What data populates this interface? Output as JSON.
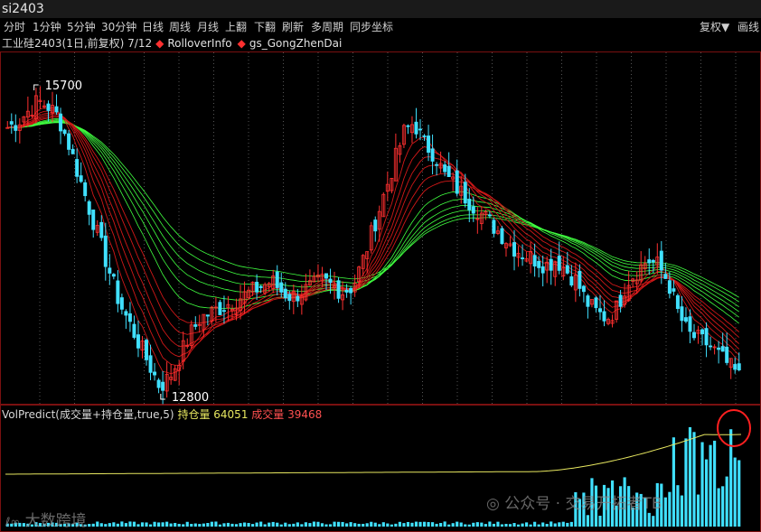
{
  "window": {
    "title": "si2403"
  },
  "toolbar": {
    "tabs": [
      "分时",
      "1分钟",
      "5分钟",
      "30分钟",
      "日线",
      "周线",
      "月线",
      "上翻",
      "下翻",
      "刷新",
      "多周期",
      "同步坐标"
    ],
    "right_items": [
      "复权▼",
      "画线"
    ]
  },
  "main_legend": {
    "instrument": "工业硅2403(1日,前复权) 7/12",
    "indicator_1": "RolloverInfo",
    "indicator_2": "gs_GongZhenDai"
  },
  "annotations": {
    "high": "15700",
    "low": "12800"
  },
  "sub_legend": {
    "indicator": "VolPredict(成交量+持仓量,true,5)",
    "oi_label": "持仓量",
    "oi_value": "64051",
    "vol_label": "成交量",
    "vol_value": "39468"
  },
  "watermarks": {
    "left": "大数跨境",
    "right": "公众号 · 交易开拓者TB"
  },
  "colors": {
    "background": "#000000",
    "up_candle": "#ff3030",
    "down_candle": "#40e0ff",
    "ribbon_red": "#d01818",
    "ribbon_green": "#40ff40",
    "oi_line": "#e8e860",
    "volume_bar": "#40e0ff",
    "highlight_circle": "#ff2020"
  },
  "chart_data": {
    "type": "candlestick",
    "high": 15700,
    "low": 12800,
    "close_path": [
      15350,
      15400,
      15500,
      15600,
      15550,
      15450,
      15200,
      14900,
      14600,
      14300,
      14000,
      13700,
      13500,
      13300,
      13100,
      12900,
      13000,
      13200,
      13400,
      13550,
      13600,
      13650,
      13700,
      13750,
      13800,
      13850,
      13900,
      13800,
      13750,
      13800,
      13850,
      13900,
      13850,
      13800,
      13850,
      14100,
      14400,
      14700,
      15000,
      15300,
      15400,
      15200,
      15100,
      14900,
      14800,
      14700,
      14600,
      14500,
      14400,
      14300,
      14200,
      14150,
      14100,
      14050,
      14100,
      14000,
      13900,
      13700,
      13600,
      13550,
      13650,
      13900,
      14000,
      14100,
      14050,
      13900,
      13600,
      13400,
      13350,
      13300,
      13200,
      13100,
      13000
    ]
  }
}
